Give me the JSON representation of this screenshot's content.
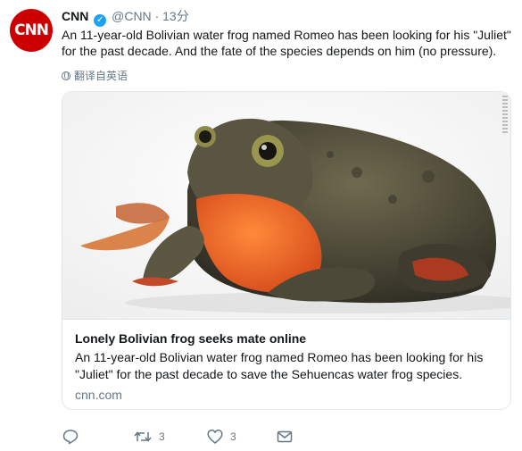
{
  "tweet": {
    "avatar_text": "CNN",
    "name": "CNN",
    "verified_mark": "✓",
    "handle": "@CNN",
    "separator": "·",
    "time": "13分",
    "text": "An 11-year-old Bolivian water frog named Romeo has been looking for his \"Juliet\" for the past decade. And the fate of the species depends on him (no pressure).",
    "translate_label": "翻译自英语"
  },
  "card": {
    "image_icon": "frog-photo",
    "title": "Lonely Bolivian frog seeks mate online",
    "description": "An 11-year-old Bolivian water frog named Romeo has been looking for his \"Juliet\" for the past decade to save the Sehuencas water frog species.",
    "domain": "cnn.com"
  },
  "actions": {
    "reply_icon": "reply-icon",
    "retweet_icon": "retweet-icon",
    "retweet_count": "3",
    "like_icon": "heart-icon",
    "like_count": "3",
    "dm_icon": "envelope-icon"
  },
  "colors": {
    "brand_red": "#cc0000",
    "verified_blue": "#1da1f2",
    "secondary_text": "#657786"
  }
}
